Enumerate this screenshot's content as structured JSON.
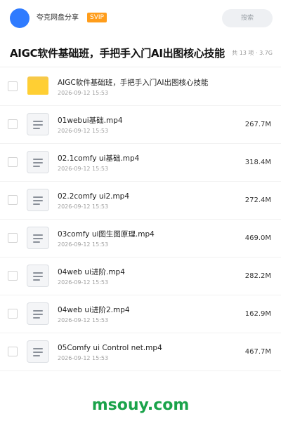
{
  "header": {
    "owner": "夸克网盘分享",
    "badge": "SVIP",
    "search_placeholder": "搜索"
  },
  "share": {
    "title": "AIGC软件基础班，手把手入门AI出图核心技能",
    "meta": "共 13 项 · 3.7G"
  },
  "items": [
    {
      "type": "folder",
      "icon": "folder-icon",
      "name": "AIGC软件基础班，手把手入门AI出图核心技能",
      "date": "2026-09-12 15:53",
      "size": ""
    },
    {
      "type": "file",
      "icon": "file-icon",
      "name": "01webui基础.mp4",
      "date": "2026-09-12 15:53",
      "size": "267.7M"
    },
    {
      "type": "file",
      "icon": "file-icon",
      "name": "02.1comfy ui基础.mp4",
      "date": "2026-09-12 15:53",
      "size": "318.4M"
    },
    {
      "type": "file",
      "icon": "file-icon",
      "name": "02.2comfy ui2.mp4",
      "date": "2026-09-12 15:53",
      "size": "272.4M"
    },
    {
      "type": "file",
      "icon": "file-icon",
      "name": "03comfy ui图生图原理.mp4",
      "date": "2026-09-12 15:53",
      "size": "469.0M"
    },
    {
      "type": "file",
      "icon": "file-icon",
      "name": "04web ui进阶.mp4",
      "date": "2026-09-12 15:53",
      "size": "282.2M"
    },
    {
      "type": "file",
      "icon": "file-icon",
      "name": "04web ui进阶2.mp4",
      "date": "2026-09-12 15:53",
      "size": "162.9M"
    },
    {
      "type": "file",
      "icon": "file-icon",
      "name": "05Comfy ui Control net.mp4",
      "date": "2026-09-12 15:53",
      "size": "467.7M"
    }
  ],
  "watermark": "msouy.com",
  "colors": {
    "avatar": "#2f7bff",
    "badge": "#ff9d1b",
    "folder": "#ffcf33",
    "watermark": "#1aa34a"
  }
}
